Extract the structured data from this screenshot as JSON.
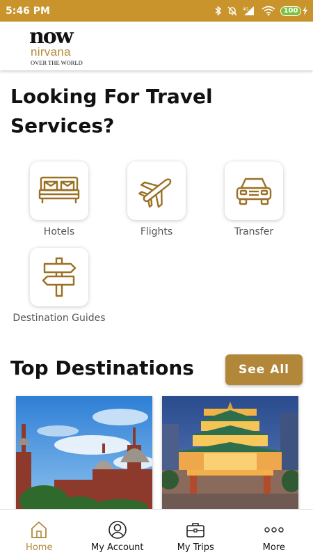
{
  "status_bar": {
    "time": "5:46 PM",
    "network": "4G",
    "battery": "100"
  },
  "brand": {
    "logo_word": "now",
    "logo_name": "nirvana",
    "logo_tagline": "OVER THE WORLD"
  },
  "heading": "Looking For Travel Services?",
  "services": [
    {
      "label": "Hotels",
      "icon": "bed-icon"
    },
    {
      "label": "Flights",
      "icon": "airplane-icon"
    },
    {
      "label": "Transfer",
      "icon": "car-icon"
    },
    {
      "label": "Destination Guides",
      "icon": "signpost-icon"
    }
  ],
  "top_destinations": {
    "title": "Top Destinations",
    "see_all_label": "See All"
  },
  "bottom_nav": [
    {
      "label": "Home",
      "icon": "home-icon",
      "active": true
    },
    {
      "label": "My Account",
      "icon": "account-icon",
      "active": false
    },
    {
      "label": "My Trips",
      "icon": "briefcase-icon",
      "active": false
    },
    {
      "label": "More",
      "icon": "more-dots-icon",
      "active": false
    }
  ],
  "colors": {
    "status_bar": "#c9942b",
    "accent": "#b3873a",
    "battery": "#7fbf3b"
  }
}
